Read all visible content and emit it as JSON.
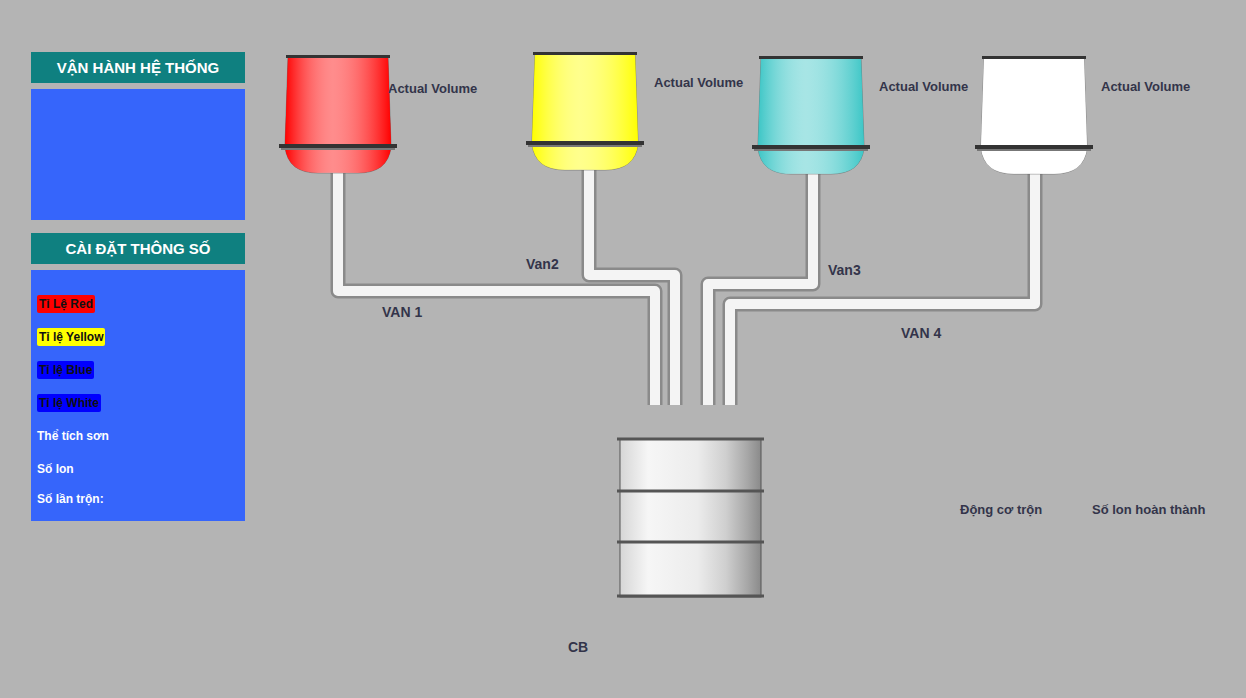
{
  "panels": {
    "operation": {
      "title": "VẬN HÀNH HỆ THỐNG"
    },
    "settings": {
      "title": "CÀI ĐẶT THÔNG SỐ",
      "items": [
        {
          "label": "Tỉ Lệ Red",
          "kind": "tag",
          "color": "#ff0000"
        },
        {
          "label": "Tỉ lệ Yellow",
          "kind": "tag",
          "color": "#ffff00"
        },
        {
          "label": "Tỉ lệ Blue",
          "kind": "tag",
          "color": "#0000ff"
        },
        {
          "label": "Tỉ lệ White",
          "kind": "tag",
          "color": "#0000ff"
        },
        {
          "label": "Thể tích sơn",
          "kind": "plain"
        },
        {
          "label": "Số lon",
          "kind": "plain"
        },
        {
          "label": "Số lần trộn:",
          "kind": "plain"
        }
      ]
    }
  },
  "tanks": [
    {
      "label": "Actual Volume",
      "color": "#ff0000"
    },
    {
      "label": "Actual Volume",
      "color": "#ffff00"
    },
    {
      "label": "Actual Volume",
      "color": "#3cc6c6"
    },
    {
      "label": "Actual Volume",
      "color": "#ffffff"
    }
  ],
  "valves": [
    "VAN 1",
    "Van2",
    "Van3",
    "VAN 4"
  ],
  "mixer": {
    "motor_label": "Động cơ trộn",
    "done_label": "Số lon hoàn thành",
    "sensor_label": "CB"
  }
}
